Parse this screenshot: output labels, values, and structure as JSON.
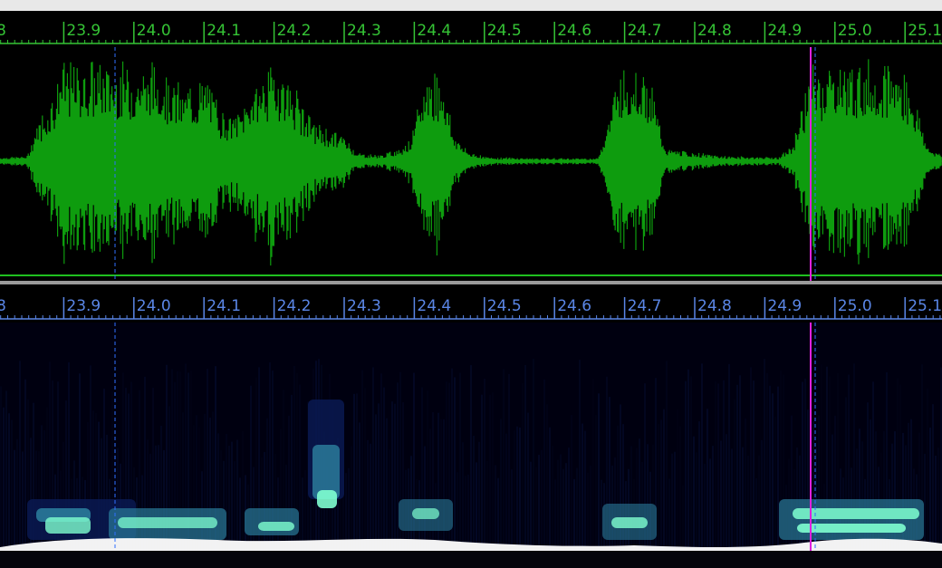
{
  "waveform_ruler": {
    "labels": [
      "8",
      "23.9",
      "24.0",
      "24.1",
      "24.2",
      "24.3",
      "24.4",
      "24.5",
      "24.6",
      "24.7",
      "24.8",
      "24.9",
      "25.0",
      "25.1"
    ],
    "color": "#35c435"
  },
  "spectrogram_ruler": {
    "labels": [
      "8",
      "23.9",
      "24.0",
      "24.1",
      "24.2",
      "24.3",
      "24.4",
      "24.5",
      "24.6",
      "24.7",
      "24.8",
      "24.9",
      "25.0",
      "25.1"
    ],
    "color": "#5a86e6"
  },
  "waveform": {
    "color": "#0e9c0e",
    "baseline_color": "#1fbf1f"
  },
  "cursors": {
    "playhead_color": "#e020e0",
    "marker_color": "#2f6fff"
  },
  "spectrogram": {
    "colors": {
      "background": "#000010",
      "low": "#0a1a55",
      "mid": "#2a7a9a",
      "high": "#7fffd0",
      "peak": "#ffffff"
    }
  }
}
